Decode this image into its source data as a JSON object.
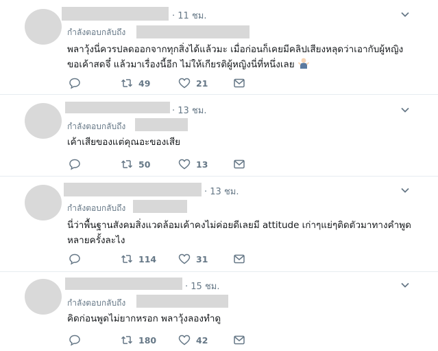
{
  "tweets": [
    {
      "time": "· 11 ชม.",
      "replying_to": "กำลังตอบกลับถึง",
      "lines": [
        "พลาวุ้งนี่ควรปลดออกจากทุกสิ่งได้แล้วมะ เมื่อก่อนก็เคยมีคลิปเสียงหลุดว่าเอากับผู้หญิง",
        "ขอเค้าสดจึ๋ แล้วมาเรื่องนี้อีก ไม่ให้เกียรติผู้หญิงนี่ที่หนึ่งเลย"
      ],
      "emoji": "man-shrugging-emoji",
      "retweets": "49",
      "likes": "21"
    },
    {
      "time": "· 13 ชม.",
      "replying_to": "กำลังตอบกลับถึง",
      "lines": [
        "เค้าเสียของแต่คุณอะของเสีย"
      ],
      "retweets": "50",
      "likes": "13"
    },
    {
      "time": "· 13 ชม.",
      "replying_to": "กำลังตอบกลับถึง",
      "lines": [
        "นี่ว่าพื้นฐานสังคมสิ่งแวดล้อมเค้าคงไม่ค่อยดีเลยมี attitude เก่าๆแย่ๆติดตัวมาทางคำพูด",
        "หลายครั้งละไง"
      ],
      "retweets": "114",
      "likes": "31"
    },
    {
      "time": "· 15 ชม.",
      "replying_to": "กำลังตอบกลับถึง",
      "lines": [
        "คิดก่อนพูดไม่ยากหรอก พลาวุ้งลองทำดู"
      ],
      "retweets": "180",
      "likes": "42"
    }
  ],
  "colors": {
    "muted": "#657786",
    "text": "#14171a",
    "redacted": "#d8d8d8",
    "divider": "#e6ecf0"
  },
  "icons": [
    "reply-icon",
    "retweet-icon",
    "like-icon",
    "message-icon",
    "chevron-down-icon"
  ]
}
